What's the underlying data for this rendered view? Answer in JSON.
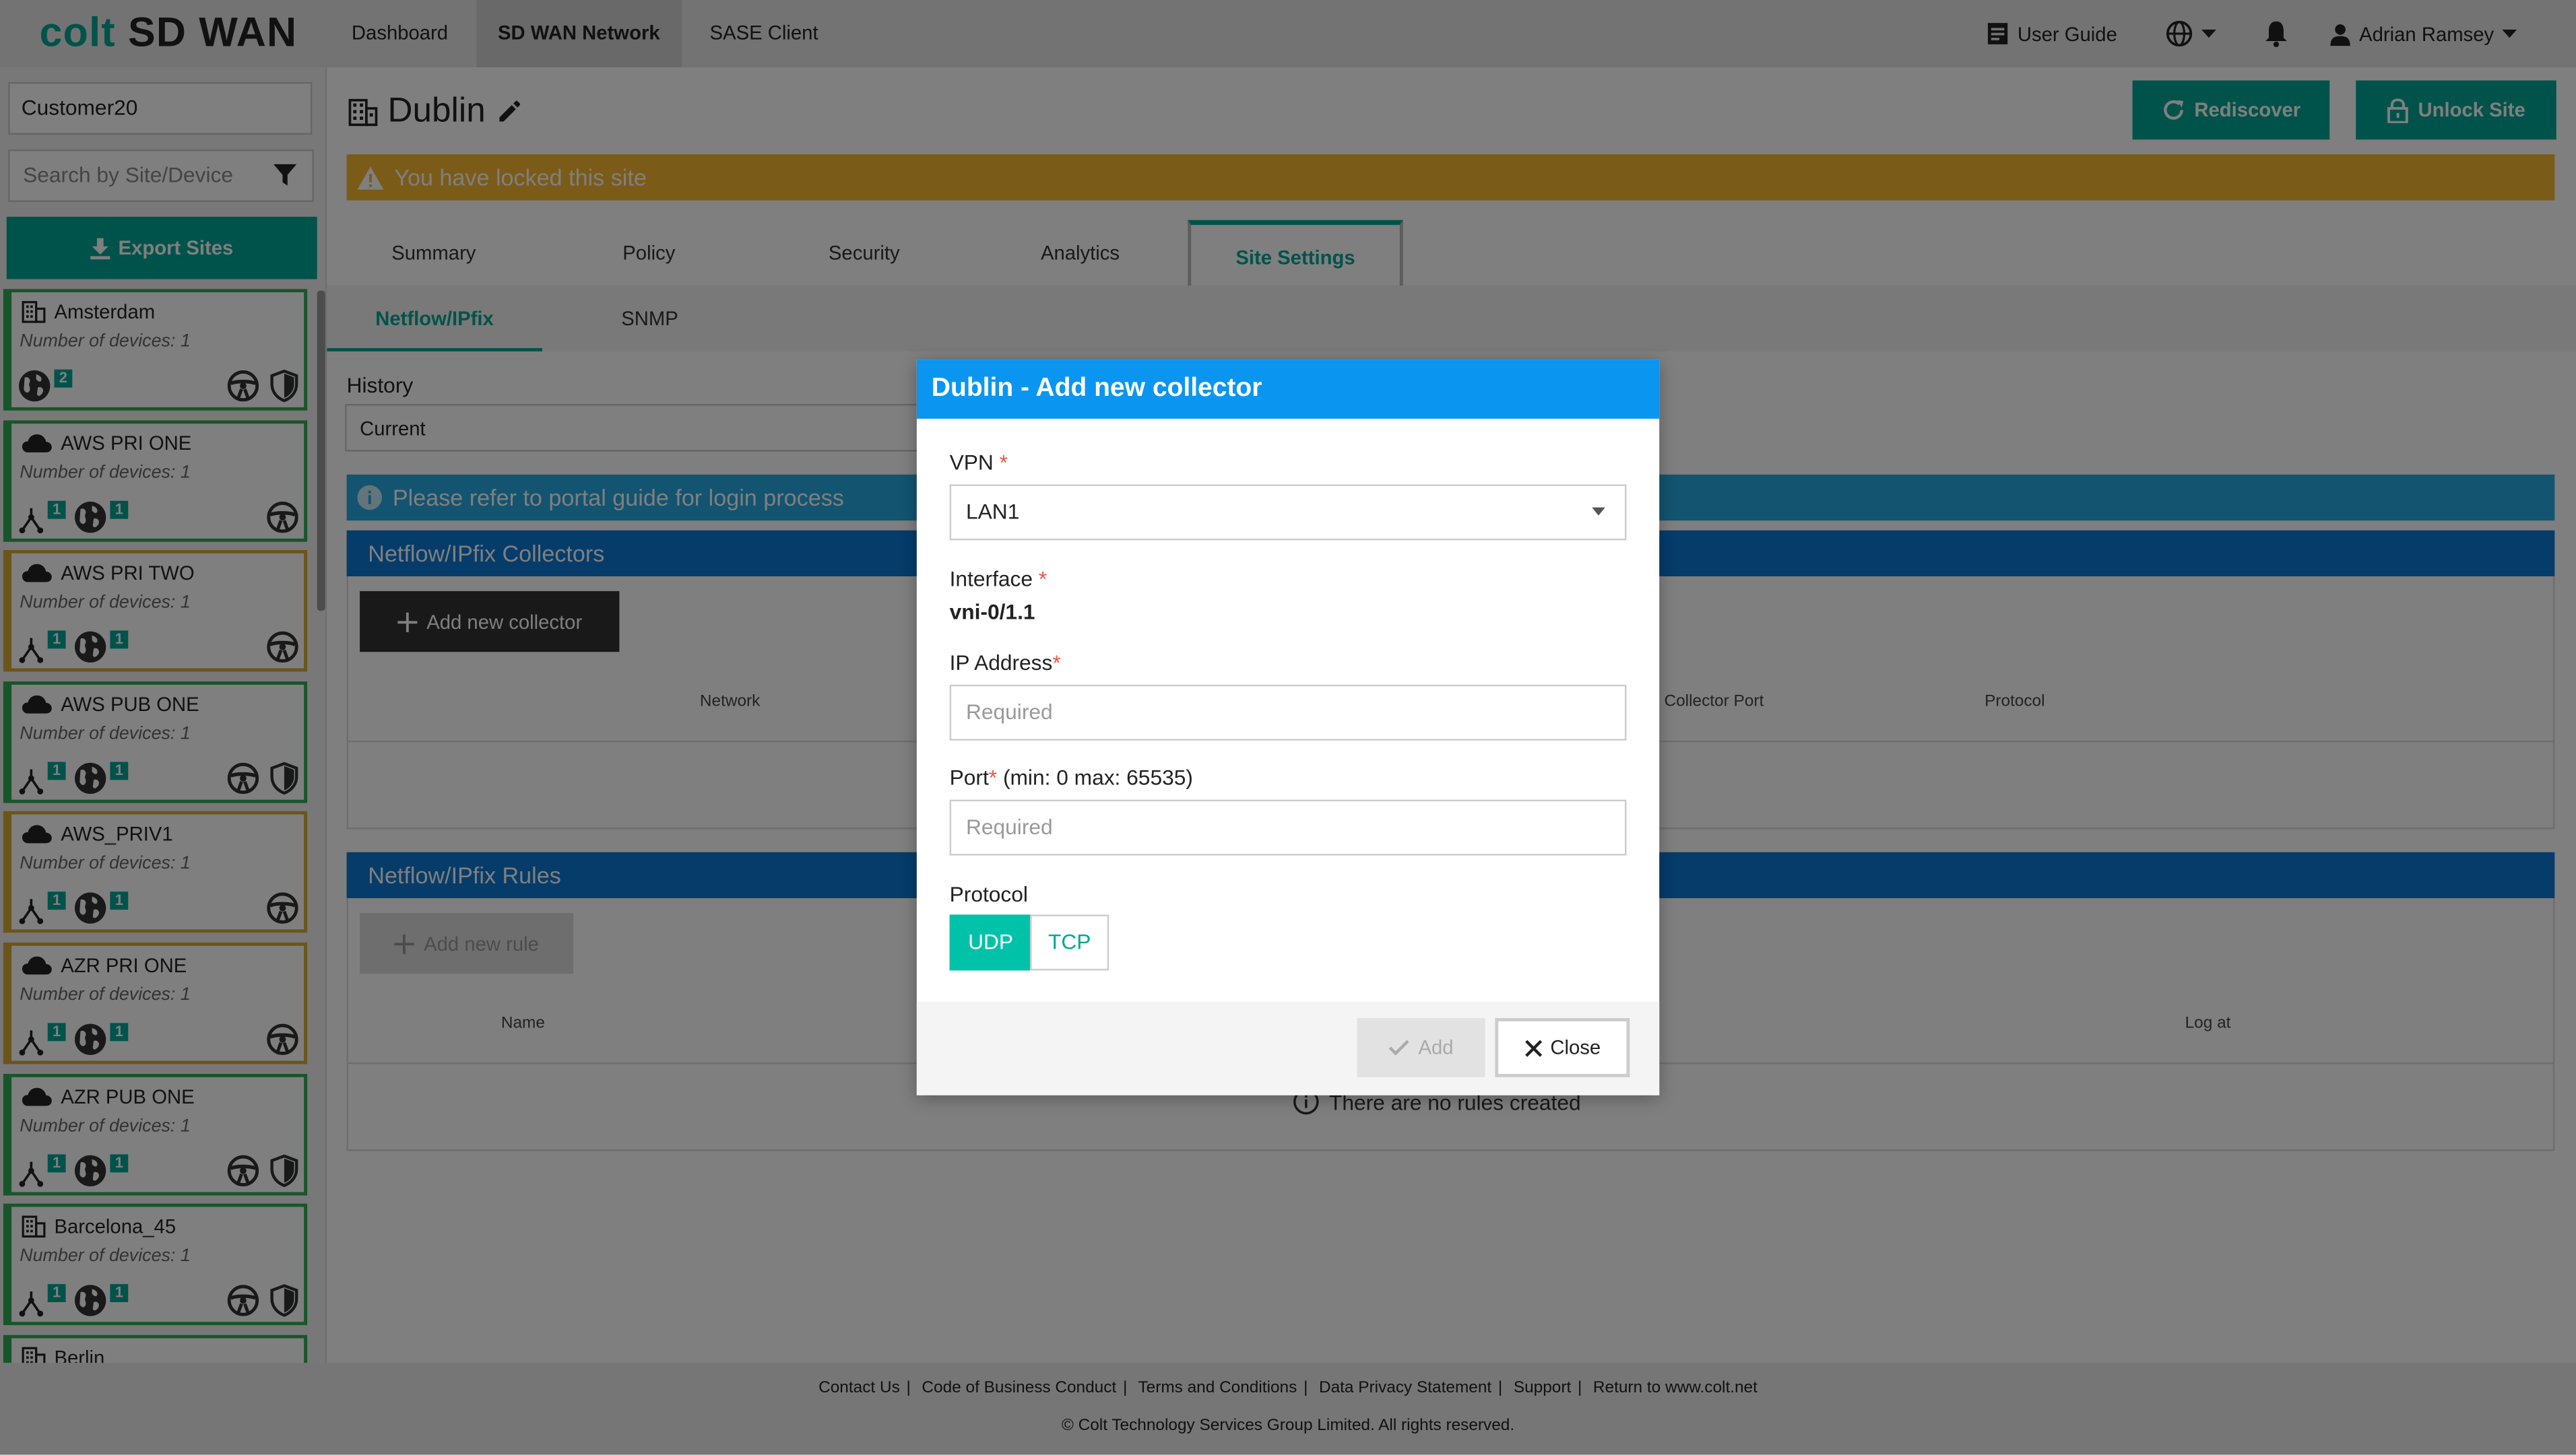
{
  "app": {
    "logo_brand": "colt",
    "logo_product": "SD WAN",
    "nav": [
      "Dashboard",
      "SD WAN Network",
      "SASE Client"
    ],
    "active_nav": "SD WAN Network",
    "user_guide": "User Guide",
    "user_name": "Adrian Ramsey"
  },
  "colors": {
    "brand_teal": "#00a795",
    "warning": "#f7b731",
    "info": "#26a9e0",
    "section_blue": "#0a78d4",
    "modal_header": "#0a96f0"
  },
  "sidebar": {
    "customer": "Customer20",
    "search_placeholder": "Search by Site/Device",
    "export_label": "Export Sites",
    "sites": [
      {
        "name": "Amsterdam",
        "devices": "Number of devices: 1",
        "type": "building",
        "status": "ok",
        "lan": null,
        "internet": "2",
        "has_shield": true
      },
      {
        "name": "AWS PRI ONE",
        "devices": "Number of devices: 1",
        "type": "cloud",
        "status": "ok",
        "lan": "1",
        "internet": "1",
        "has_shield": false
      },
      {
        "name": "AWS PRI TWO",
        "devices": "Number of devices: 1",
        "type": "cloud",
        "status": "warn",
        "lan": "1",
        "internet": "1",
        "has_shield": false
      },
      {
        "name": "AWS PUB ONE",
        "devices": "Number of devices: 1",
        "type": "cloud",
        "status": "ok",
        "lan": "1",
        "internet": "1",
        "has_shield": true
      },
      {
        "name": "AWS_PRIV1",
        "devices": "Number of devices: 1",
        "type": "cloud",
        "status": "warn",
        "lan": "1",
        "internet": "1",
        "has_shield": false
      },
      {
        "name": "AZR PRI ONE",
        "devices": "Number of devices: 1",
        "type": "cloud",
        "status": "warn",
        "lan": "1",
        "internet": "1",
        "has_shield": false
      },
      {
        "name": "AZR PUB ONE",
        "devices": "Number of devices: 1",
        "type": "cloud",
        "status": "ok",
        "lan": "1",
        "internet": "1",
        "has_shield": true
      },
      {
        "name": "Barcelona_45",
        "devices": "Number of devices: 1",
        "type": "building",
        "status": "ok",
        "lan": "1",
        "internet": "1",
        "has_shield": true
      },
      {
        "name": "Berlin",
        "devices": "",
        "type": "building",
        "status": "ok",
        "lan": null,
        "internet": null,
        "has_shield": false
      }
    ]
  },
  "main": {
    "site_title": "Dublin",
    "rediscover_label": "Rediscover",
    "unlock_label": "Unlock Site",
    "lock_banner": "You have locked this site",
    "tabs": [
      "Summary",
      "Policy",
      "Security",
      "Analytics",
      "Site Settings"
    ],
    "active_tab": "Site Settings",
    "subtabs": [
      "Netflow/IPfix",
      "SNMP"
    ],
    "active_subtab": "Netflow/IPfix",
    "history_label": "History",
    "history_value": "Current",
    "info_text": "Please refer to portal guide for login process",
    "collectors_title": "Netflow/IPfix Collectors",
    "add_collector_label": "Add new collector",
    "collector_columns": {
      "network": "Network",
      "port": "Collector Port",
      "protocol": "Protocol"
    },
    "rules_title": "Netflow/IPfix Rules",
    "add_rule_label": "Add new rule",
    "rule_columns": {
      "name": "Name",
      "log_at": "Log at"
    },
    "no_rules": "There are no rules created"
  },
  "footer": {
    "links": [
      "Contact Us",
      "Code of Business Conduct",
      "Terms and Conditions",
      "Data Privacy Statement",
      "Support",
      "Return to www.colt.net"
    ],
    "copyright": "© Colt Technology Services Group Limited. All rights reserved."
  },
  "modal": {
    "title": "Dublin - Add new collector",
    "vpn_label": "VPN",
    "vpn_value": "LAN1",
    "interface_label": "Interface",
    "interface_value": "vni-0/1.1",
    "ip_label": "IP Address",
    "ip_placeholder": "Required",
    "port_label": "Port",
    "port_hint": "(min: 0 max: 65535)",
    "port_placeholder": "Required",
    "protocol_label": "Protocol",
    "protocol_options": [
      "UDP",
      "TCP"
    ],
    "protocol_selected": "UDP",
    "add_label": "Add",
    "close_label": "Close"
  }
}
